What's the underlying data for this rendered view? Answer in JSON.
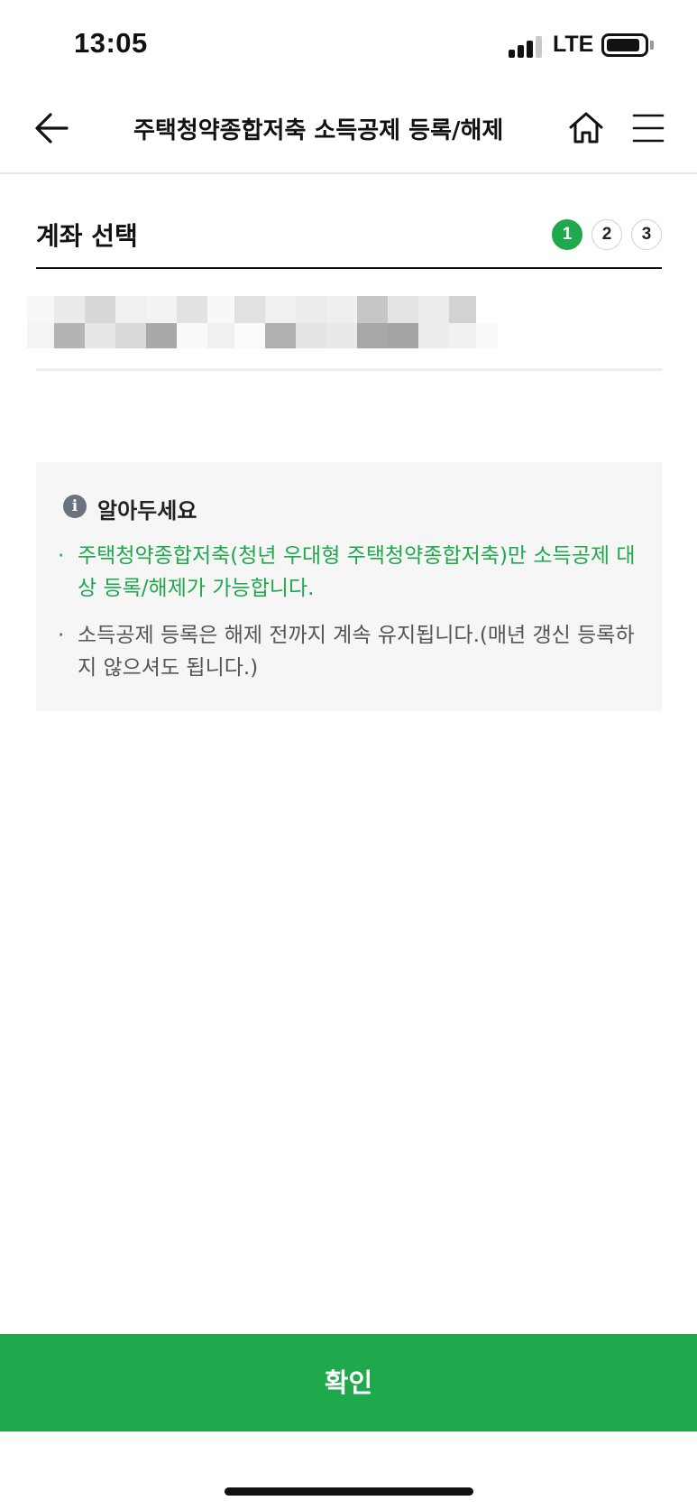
{
  "status_bar": {
    "time": "13:05",
    "network": "LTE",
    "icons": [
      "signal-bars-icon",
      "battery-icon"
    ]
  },
  "header": {
    "title": "주택청약종합저축 소득공제 등록/해제",
    "icons": [
      "back-arrow-icon",
      "home-icon",
      "hamburger-menu-icon"
    ]
  },
  "section": {
    "title": "계좌 선택",
    "steps": [
      "1",
      "2",
      "3"
    ],
    "active_step": 1
  },
  "notice": {
    "title": "알아두세요",
    "icon": "info-icon",
    "bullet": "·",
    "items": [
      "주택청약종합저축(청년 우대형 주택청약종합저축)만 소득공제 대상 등록/해제가 가능합니다.",
      "소득공제 등록은 해제 전까지 계속 유지됩니다.(매년 갱신 등록하지 않으셔도 됩니다.)"
    ],
    "colors": {
      "highlight": "#1fa84c",
      "normal": "#555555",
      "background": "#f6f6f6"
    }
  },
  "confirm_button": {
    "label": "확인"
  },
  "colors": {
    "accent": "#1fa84c",
    "text": "#111111",
    "divider": "#e6e6e6"
  }
}
